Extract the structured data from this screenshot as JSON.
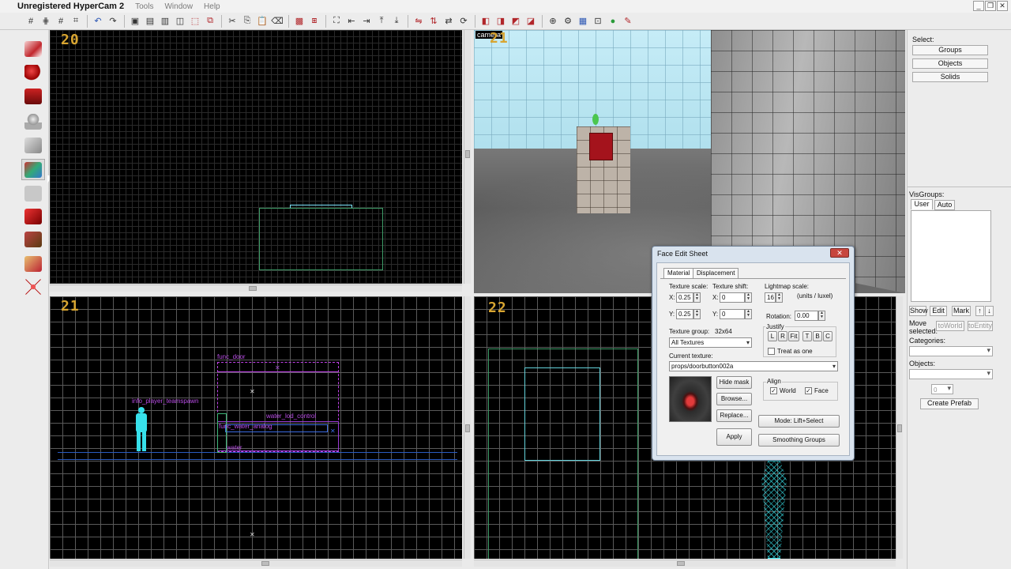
{
  "app": {
    "title": "Unregistered HyperCam 2",
    "menu": [
      "Tools",
      "Window",
      "Help"
    ],
    "window_buttons": [
      "_",
      "❐",
      "✕"
    ]
  },
  "viewports": {
    "top_left_num": "20",
    "bottom_left_num": "21",
    "bottom_right_num": "22",
    "camera_label": "camera",
    "camera_num": "21"
  },
  "entity_labels": {
    "func_door": "func_door",
    "info_player": "info_player_teamspawn",
    "water_lod": "water_lod_control",
    "water_analog": "func_water_analog",
    "water": "water"
  },
  "select_panel": {
    "label": "Select:",
    "groups": "Groups",
    "objects": "Objects",
    "solids": "Solids"
  },
  "visgroups": {
    "label": "VisGroups:",
    "tab_user": "User",
    "tab_auto": "Auto",
    "show": "Show",
    "edit": "Edit",
    "mark": "Mark",
    "up": "↑",
    "down": "↓"
  },
  "move_selected": {
    "label": "Move selected:",
    "to_world": "toWorld",
    "to_entity": "toEntity"
  },
  "prefab": {
    "categories_label": "Categories:",
    "objects_label": "Objects:",
    "count": "0",
    "create": "Create Prefab"
  },
  "face_edit": {
    "title": "Face Edit Sheet",
    "close": "✕",
    "tab_material": "Material",
    "tab_displacement": "Displacement",
    "texture_scale_label": "Texture scale:",
    "texture_shift_label": "Texture shift:",
    "lightmap_label": "Lightmap scale:",
    "units_label": "(units / luxel)",
    "x": "X:",
    "y": "Y:",
    "scale_x": "0.25",
    "scale_y": "0.25",
    "shift_x": "0",
    "shift_y": "0",
    "lightmap": "16",
    "rotation_label": "Rotation:",
    "rotation": "0.00",
    "justify_label": "Justify",
    "justify_l": "L",
    "justify_r": "R",
    "justify_fit": "Fit",
    "justify_t": "T",
    "justify_b": "B",
    "justify_c": "C",
    "treat_as_one": "Treat as one",
    "texture_group_label": "Texture group:",
    "texture_group_size": "32x64",
    "texture_group_value": "All Textures",
    "current_texture_label": "Current texture:",
    "current_texture": "props/doorbutton002a",
    "hide_mask": "Hide mask",
    "browse": "Browse...",
    "replace": "Replace...",
    "apply": "Apply",
    "align_label": "Align",
    "align_world": "World",
    "align_face": "Face",
    "mode": "Mode: Lift+Select",
    "smoothing": "Smoothing Groups"
  }
}
